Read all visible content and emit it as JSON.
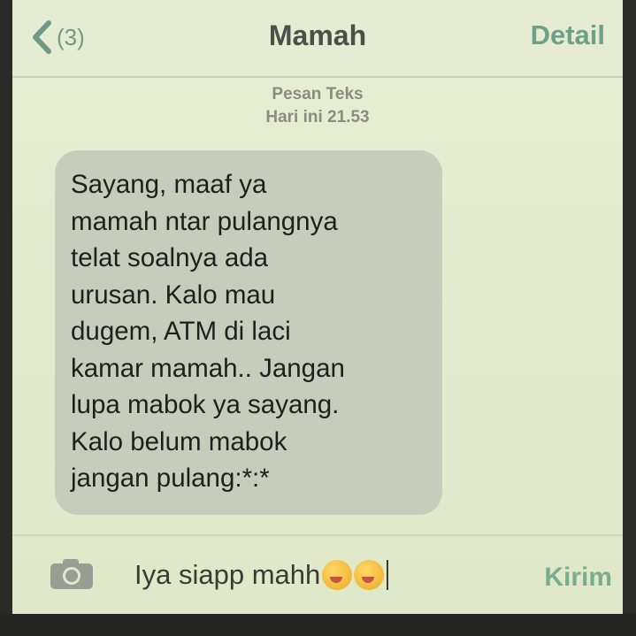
{
  "navbar": {
    "back_count": "(3)",
    "title": "Mamah",
    "detail_label": "Detail"
  },
  "meta": {
    "type": "Pesan Teks",
    "time": "Hari ini 21.53"
  },
  "message": {
    "text": "Sayang, maaf ya\nmamah ntar pulangnya\ntelat soalnya ada\nurusan. Kalo mau\ndugem, ATM di laci\nkamar mamah.. Jangan\nlupa mabok ya sayang.\nKalo belum mabok\njangan pulang:*:*"
  },
  "compose": {
    "input_text": "Iya siapp mahh",
    "emoji_icon": "face-tongue-wink-icon",
    "send_label": "Kirim",
    "camera_icon": "camera-icon"
  },
  "colors": {
    "accent": "#6fa08a",
    "background": "#e5ecd2",
    "bubble": "#c8ccbc"
  }
}
